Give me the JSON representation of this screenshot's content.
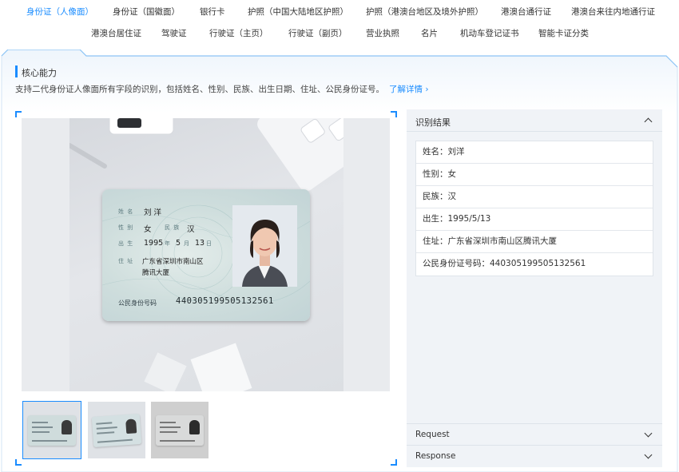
{
  "tabs": [
    {
      "label": "身份证（人像面）",
      "active": true
    },
    {
      "label": "身份证（国徽面）"
    },
    {
      "label": "银行卡"
    },
    {
      "label": "护照（中国大陆地区护照）"
    },
    {
      "label": "护照（港澳台地区及境外护照）"
    },
    {
      "label": "港澳台通行证"
    },
    {
      "label": "港澳台来往内地通行证"
    },
    {
      "label": "港澳台居住证"
    },
    {
      "label": "驾驶证"
    },
    {
      "label": "行驶证（主页）"
    },
    {
      "label": "行驶证（副页）"
    },
    {
      "label": "营业执照"
    },
    {
      "label": "名片"
    },
    {
      "label": "机动车登记证书"
    },
    {
      "label": "智能卡证分类"
    }
  ],
  "section": {
    "title": "核心能力",
    "description": "支持二代身份证人像面所有字段的识别，包括姓名、性别、民族、出生日期、住址、公民身份证号。",
    "link": "了解详情 ›"
  },
  "card": {
    "name_label": "姓 名",
    "name": "刘 洋",
    "gender_label": "性 别",
    "gender": "女",
    "ethnic_label": "民 族",
    "ethnic": "汉",
    "birth_label": "出 生",
    "birth_year": "1995",
    "birth_year_unit": "年",
    "birth_month": "5",
    "birth_month_unit": "月",
    "birth_day": "13",
    "birth_day_unit": "日",
    "address_label": "住 址",
    "address_line1": "广东省深圳市南山区",
    "address_line2": "腾讯大厦",
    "id_label": "公民身份号码",
    "id_number": "440305199505132561"
  },
  "result": {
    "title": "识别结果",
    "rows": [
      "姓名：刘洋",
      "性别：女",
      "民族：汉",
      "出生：1995/5/13",
      "住址：广东省深圳市南山区腾讯大厦",
      "公民身份证号码：440305199505132561"
    ],
    "request_label": "Request",
    "response_label": "Response"
  },
  "colors": {
    "accent": "#1a8cff",
    "panel_bg": "#f0f3f7"
  }
}
